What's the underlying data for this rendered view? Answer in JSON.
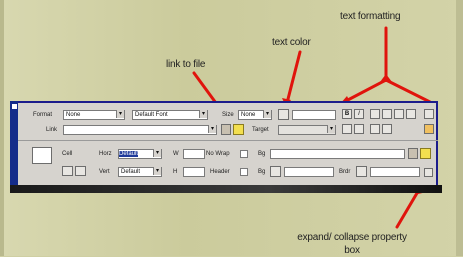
{
  "annotations": {
    "text_formatting": "text formatting",
    "text_color": "text color",
    "link_to_file": "link to file",
    "expand_collapse": "expand/ collapse property box"
  },
  "property_panel": {
    "row1": {
      "format_label": "Format",
      "format_value": "None",
      "font_value": "Default Font",
      "size_label": "Size",
      "size_value": "None",
      "bold_label": "B",
      "italic_label": "I"
    },
    "row2": {
      "link_label": "Link",
      "target_label": "Target"
    },
    "cell_row1": {
      "cell_label": "Cell",
      "horz_label": "Horz",
      "horz_value": "Default",
      "w_label": "W",
      "nowrap_label": "No Wrap",
      "bg_label": "Bg"
    },
    "cell_row2": {
      "vert_label": "Vert",
      "vert_value": "Default",
      "h_label": "H",
      "header_label": "Header",
      "bg_label": "Bg",
      "brdr_label": "Brdr"
    }
  },
  "colors": {
    "background": "#cfcfa3",
    "panel": "#d6d3ce",
    "title_bar": "#142c8a",
    "arrow": "#e0140c"
  },
  "icons": [
    "folder-icon",
    "color-swatch-icon",
    "align-left-icon",
    "align-center-icon",
    "align-right-icon",
    "justify-icon",
    "unordered-list-icon",
    "ordered-list-icon",
    "outdent-icon",
    "indent-icon",
    "help-icon",
    "edit-icon",
    "expand-collapse-icon",
    "merge-cells-icon",
    "split-cell-icon",
    "table-cell-icon"
  ]
}
